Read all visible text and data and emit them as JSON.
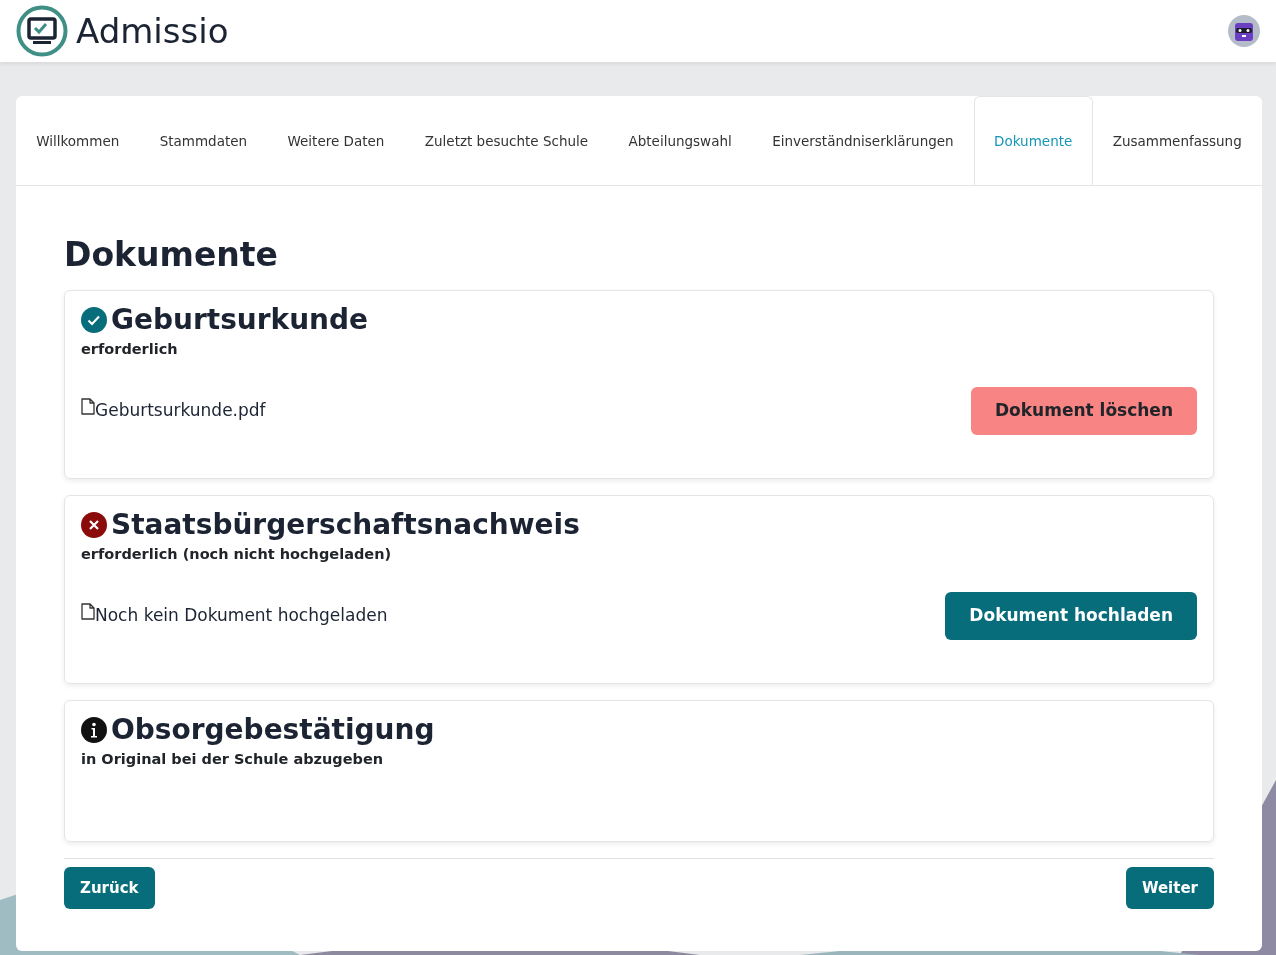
{
  "app": {
    "title": "Admissio"
  },
  "tabs": [
    {
      "label": "Willkommen",
      "selected": false
    },
    {
      "label": "Stammdaten",
      "selected": false
    },
    {
      "label": "Weitere Daten",
      "selected": false
    },
    {
      "label": "Zuletzt besuchte Schule",
      "selected": false
    },
    {
      "label": "Abteilungswahl",
      "selected": false
    },
    {
      "label": "Einverständniserklärungen",
      "selected": false
    },
    {
      "label": "Dokumente",
      "selected": true
    },
    {
      "label": "Zusammenfassung",
      "selected": false
    }
  ],
  "page": {
    "heading": "Dokumente"
  },
  "documents": [
    {
      "kind": "done",
      "title": "Geburtsurkunde",
      "requirement": "erforderlich",
      "file": "Geburtsurkunde.pdf",
      "action": {
        "kind": "delete",
        "label": "Dokument löschen"
      }
    },
    {
      "kind": "missing",
      "title": "Staatsbürgerschaftsnachweis",
      "requirement": "erforderlich (noch nicht hochgeladen)",
      "file": "Noch kein Dokument hochgeladen",
      "action": {
        "kind": "upload",
        "label": "Dokument hochladen"
      }
    },
    {
      "kind": "info",
      "title": "Obsorgebestätigung",
      "requirement": "in Original bei der Schule abzugeben"
    }
  ],
  "footer": {
    "back": "Zurück",
    "next": "Weiter"
  }
}
